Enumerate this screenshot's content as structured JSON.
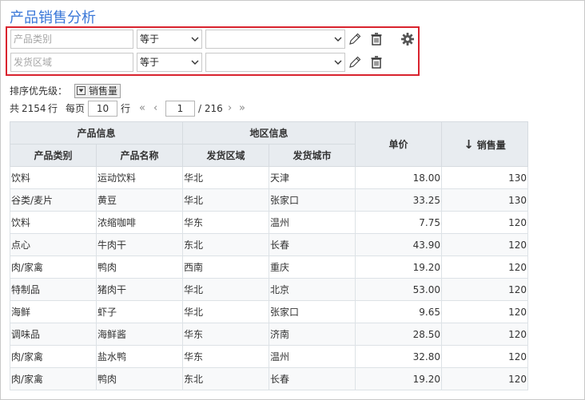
{
  "title": "产品销售分析",
  "filters": [
    {
      "field": "产品类别",
      "operator": "等于",
      "value": ""
    },
    {
      "field": "发货区域",
      "operator": "等于",
      "value": ""
    }
  ],
  "icons": {
    "edit": "pencil-icon",
    "delete": "trash-icon",
    "settings": "gear-icon",
    "sort_desc": "arrow-down-icon"
  },
  "sort": {
    "label": "排序优先级：",
    "field": "销售量"
  },
  "pager": {
    "total_prefix": "共",
    "total": "2154",
    "total_suffix": "行",
    "per_page_prefix": "每页",
    "per_page": "10",
    "per_page_suffix": "行",
    "current_page": "1",
    "total_pages": "/ 216"
  },
  "table": {
    "group_headers": {
      "product": "产品信息",
      "region": "地区信息"
    },
    "columns": {
      "category": "产品类别",
      "name": "产品名称",
      "area": "发货区域",
      "city": "发货城市",
      "price": "单价",
      "sales": "销售量"
    },
    "sort_arrow": "↓",
    "rows": [
      [
        "饮料",
        "运动饮料",
        "华北",
        "天津",
        "18.00",
        "130"
      ],
      [
        "谷类/麦片",
        "黄豆",
        "华北",
        "张家口",
        "33.25",
        "130"
      ],
      [
        "饮料",
        "浓缩咖啡",
        "华东",
        "温州",
        "7.75",
        "120"
      ],
      [
        "点心",
        "牛肉干",
        "东北",
        "长春",
        "43.90",
        "120"
      ],
      [
        "肉/家禽",
        "鸭肉",
        "西南",
        "重庆",
        "19.20",
        "120"
      ],
      [
        "特制品",
        "猪肉干",
        "华北",
        "北京",
        "53.00",
        "120"
      ],
      [
        "海鲜",
        "虾子",
        "华北",
        "张家口",
        "9.65",
        "120"
      ],
      [
        "调味品",
        "海鲜酱",
        "华东",
        "济南",
        "28.50",
        "120"
      ],
      [
        "肉/家禽",
        "盐水鸭",
        "华东",
        "温州",
        "32.80",
        "120"
      ],
      [
        "肉/家禽",
        "鸭肉",
        "东北",
        "长春",
        "19.20",
        "120"
      ]
    ]
  }
}
